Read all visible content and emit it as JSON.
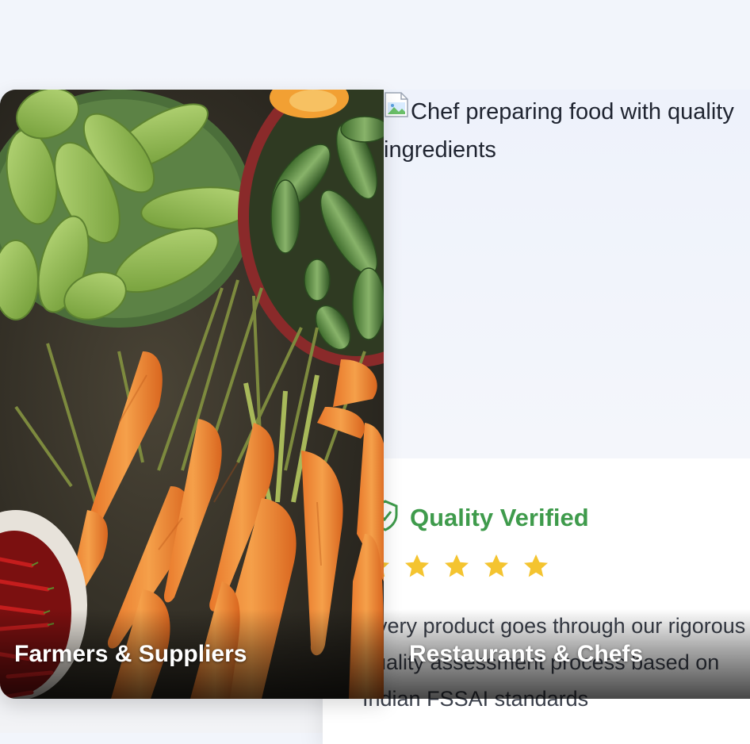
{
  "cards": [
    {
      "label": "Farmers & Suppliers"
    },
    {
      "label": "Restaurants & Chefs",
      "image_alt": "Chef preparing food with quality ingredients"
    }
  ],
  "quality": {
    "title": "Quality Verified",
    "icon": "shield-check-icon",
    "rating": 5,
    "lines": [
      "Every product goes through our rigorous",
      "quality assessment process based on",
      "Indian FSSAI standards"
    ]
  },
  "colors": {
    "quality_green": "#3f9b4c",
    "star_yellow": "#f4c430"
  }
}
